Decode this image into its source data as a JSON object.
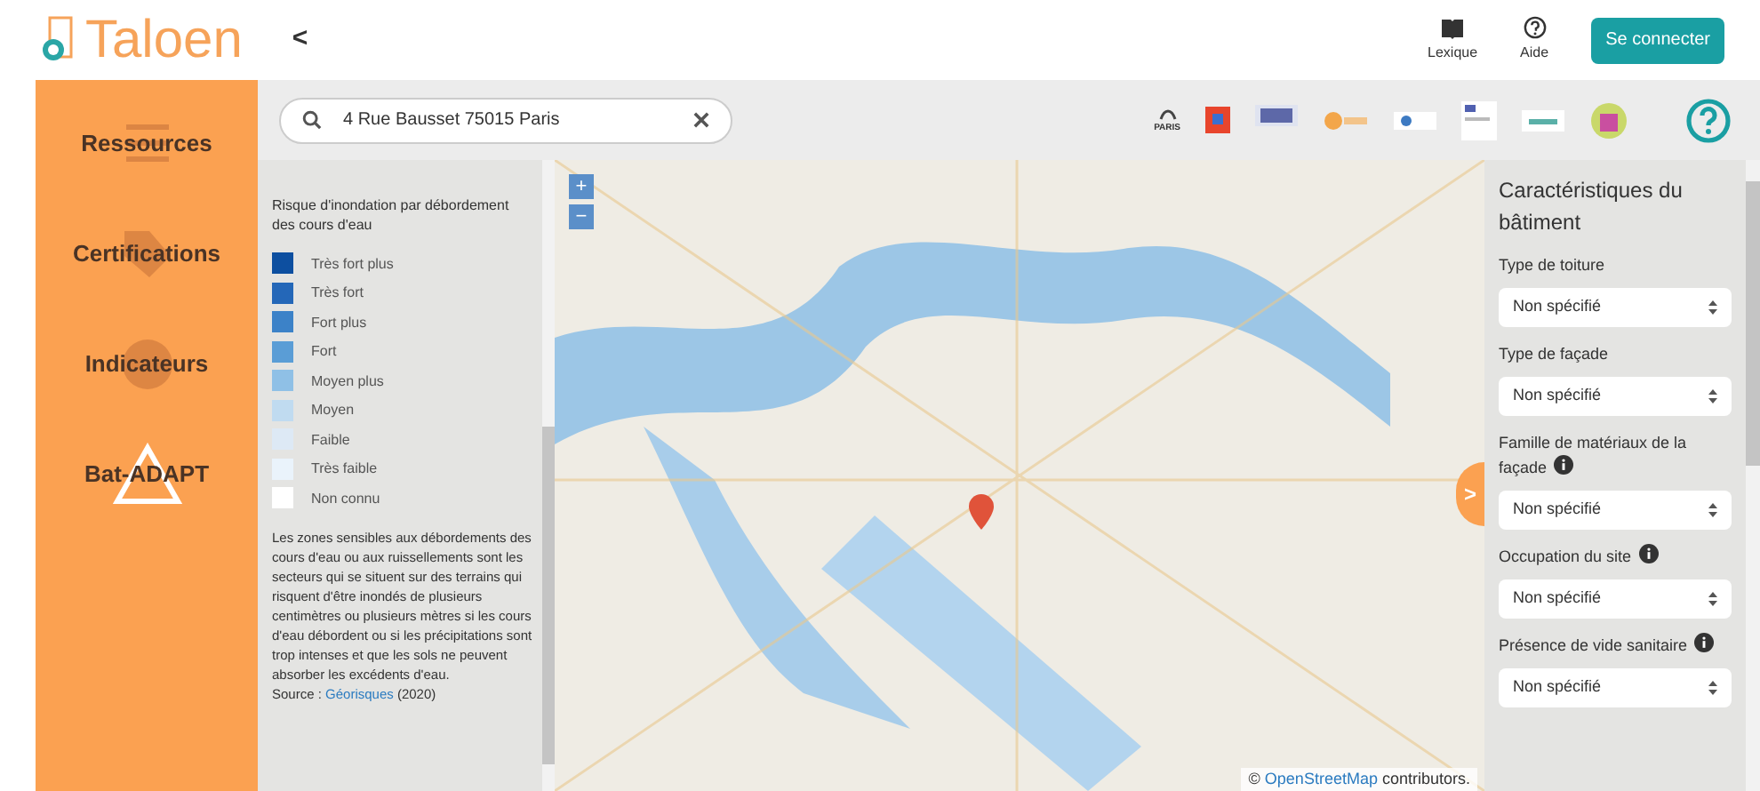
{
  "header": {
    "logo": "Taloen",
    "back": "<",
    "links": [
      {
        "kind": "book",
        "label": "Lexique"
      },
      {
        "kind": "help",
        "label": "Aide"
      }
    ],
    "login": "Se connecter"
  },
  "sidebar": {
    "items": [
      {
        "kind": "list",
        "label": "Ressources"
      },
      {
        "kind": "tag",
        "label": "Certifications"
      },
      {
        "kind": "pie",
        "label": "Indicateurs"
      },
      {
        "kind": "triangle",
        "label": "Bat-ADAPT"
      }
    ]
  },
  "search": {
    "value": "4 Rue Bausset 75015 Paris"
  },
  "partners": [
    "PARIS"
  ],
  "legend": {
    "title": "Risque d'inondation par débordement des cours d'eau",
    "items": [
      {
        "label": "Très fort plus",
        "color": "#0d4fa0"
      },
      {
        "label": "Très fort",
        "color": "#2467b8"
      },
      {
        "label": "Fort plus",
        "color": "#3c82c8"
      },
      {
        "label": "Fort",
        "color": "#5a9dd6"
      },
      {
        "label": "Moyen plus",
        "color": "#8fc0e6"
      },
      {
        "label": "Moyen",
        "color": "#c0dbf0"
      },
      {
        "label": "Faible",
        "color": "#dde9f5"
      },
      {
        "label": "Très faible",
        "color": "#eaf3fb"
      },
      {
        "label": "Non connu",
        "color": "#ffffff"
      }
    ],
    "description": "Les zones sensibles aux débordements des cours d'eau ou aux ruissellements sont les secteurs qui se situent sur des terrains qui risquent d'être inondés de plusieurs centimètres ou plusieurs mètres si les cours d'eau débordent ou si les précipitations sont trop intenses et que les sols ne peuvent absorber les excédents d'eau.",
    "source_label": "Source : ",
    "source_link": "Géorisques",
    "source_year": " (2020)"
  },
  "map": {
    "zoom_in": "+",
    "zoom_out": "−",
    "attribution_prefix": "© ",
    "attribution_link": "OpenStreetMap",
    "attribution_suffix": " contributors.",
    "toggle": ">"
  },
  "panel": {
    "title": "Caractéristiques du bâtiment",
    "fields": [
      {
        "label": "Type de toiture",
        "info": false,
        "value": "Non spécifié"
      },
      {
        "label": "Type de façade",
        "info": false,
        "value": "Non spécifié"
      },
      {
        "label": "Famille de matériaux de la façade",
        "info": true,
        "value": "Non spécifié"
      },
      {
        "label": "Occupation du site",
        "info": true,
        "value": "Non spécifié"
      },
      {
        "label": "Présence de vide sanitaire",
        "info": true,
        "value": "Non spécifié"
      }
    ]
  }
}
